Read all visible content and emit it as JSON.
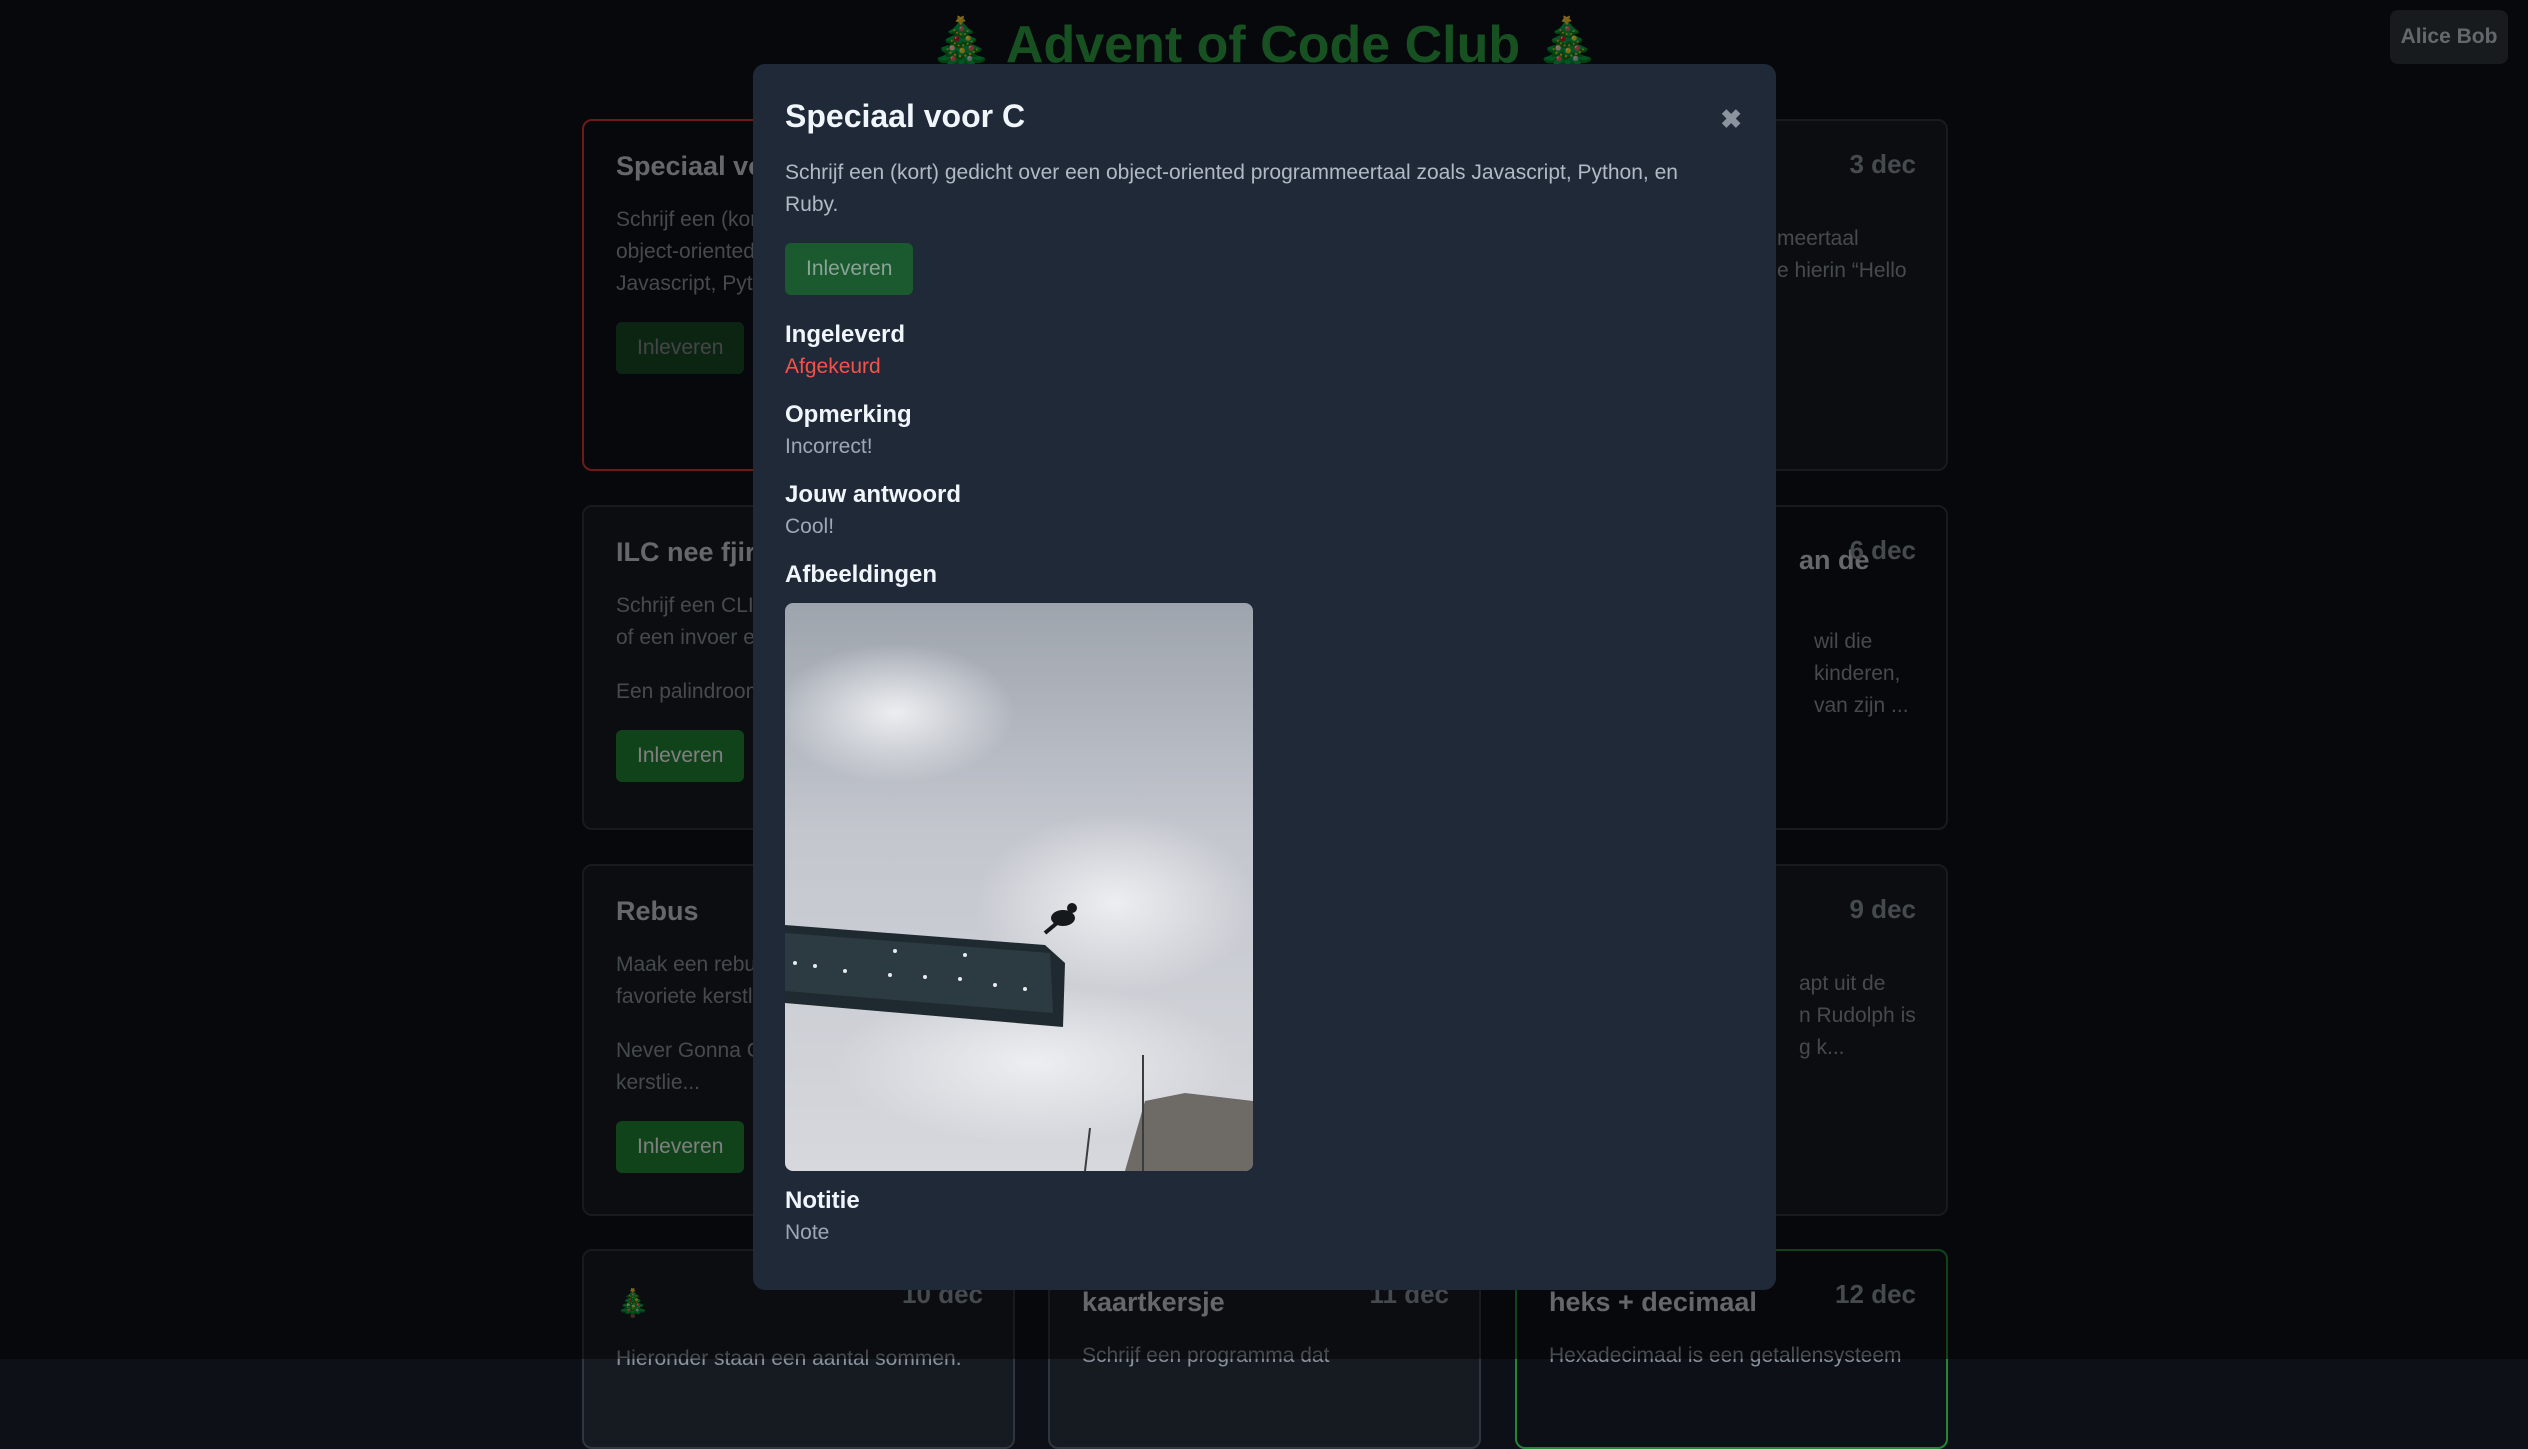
{
  "header": {
    "title": "🎄 Advent of Code Club 🎄",
    "user": "Alice Bob"
  },
  "cards": [
    {
      "title": "Speciaal voor C",
      "text": "Schrijf een (kort) gedicht over een object-oriented programmeertaal zoals Javascript, Python, en Ruby.",
      "button": "Inleveren"
    },
    {
      "date": "3 dec",
      "frag1": "meertaal",
      "frag2": "e hierin “Hello"
    },
    {
      "title": "ILC nee fjir",
      "text": "Schrijf een CLI",
      "text2": "of een invoer e",
      "text3": "Een palindroom",
      "button": "Inleveren"
    },
    {
      "date": "6 dec",
      "title_frag": "an de",
      "frag1": "wil die",
      "frag2": "kinderen,",
      "frag3": "van zijn ..."
    },
    {
      "title": "Rebus",
      "text": "Maak een rebus",
      "text2": "favoriete kerstl",
      "text3": "Never Gonna G",
      "text4": "kerstlie...",
      "button": "Inleveren"
    },
    {
      "date": "9 dec",
      "frag1": "apt uit de",
      "frag2": "n Rudolph is",
      "frag3": "g k..."
    },
    {
      "title": "🎄",
      "date": "10 dec",
      "text": "Hieronder staan een aantal sommen."
    },
    {
      "title": "kaartkersje",
      "date": "11 dec",
      "text": "Schrijf een programma dat"
    },
    {
      "title": "heks + decimaal",
      "date": "12 dec",
      "text": "Hexadecimaal is een getallensysteem"
    }
  ],
  "modal": {
    "title": "Speciaal voor C",
    "close": "✖",
    "description": "Schrijf een (kort) gedicht over een object-oriented programmeertaal zoals Javascript, Python, en Ruby.",
    "button": "Inleveren",
    "submitted_label": "Ingeleverd",
    "status": "Afgekeurd",
    "remark_label": "Opmerking",
    "remark": "Incorrect!",
    "answer_label": "Jouw antwoord",
    "answer": "Cool!",
    "images_label": "Afbeeldingen",
    "note_label": "Notitie",
    "note": "Note"
  }
}
